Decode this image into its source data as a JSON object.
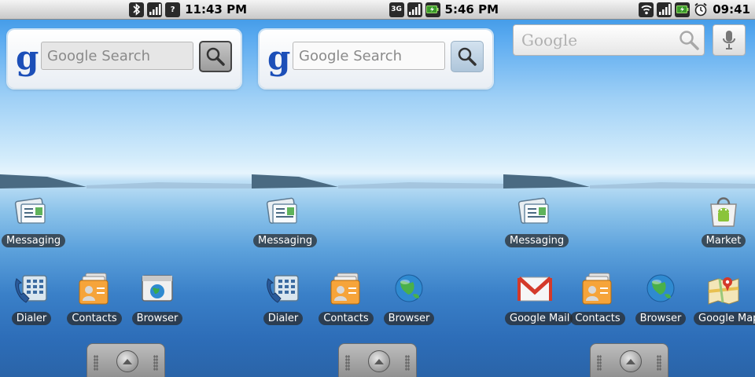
{
  "screens": [
    {
      "status": {
        "clock": "11:43 PM",
        "network_label": "",
        "icons": [
          "bluetooth-icon",
          "signal-icon",
          "unknown-icon"
        ]
      },
      "search": {
        "style": "classic",
        "placeholder": "Google Search",
        "logo": "g"
      },
      "apps": [
        {
          "label": "Messaging",
          "icon": "messaging-icon"
        },
        {
          "label": "Dialer",
          "icon": "dialer-icon"
        },
        {
          "label": "Contacts",
          "icon": "contacts-icon"
        },
        {
          "label": "Browser",
          "icon": "browser-icon"
        }
      ]
    },
    {
      "status": {
        "clock": "5:46 PM",
        "network_label": "3G",
        "icons": [
          "3g-icon",
          "signal-icon",
          "battery-icon"
        ]
      },
      "search": {
        "style": "classic",
        "placeholder": "Google Search",
        "logo": "g"
      },
      "apps": [
        {
          "label": "Messaging",
          "icon": "messaging-icon"
        },
        {
          "label": "Dialer",
          "icon": "dialer-icon"
        },
        {
          "label": "Contacts",
          "icon": "contacts-icon"
        },
        {
          "label": "Browser",
          "icon": "globe-icon"
        }
      ]
    },
    {
      "status": {
        "clock": "09:41",
        "network_label": "",
        "icons": [
          "wifi-icon",
          "signal-icon",
          "battery-icon",
          "alarm-icon"
        ]
      },
      "search": {
        "style": "modern",
        "placeholder": "Google"
      },
      "apps": [
        {
          "label": "Messaging",
          "icon": "messaging-icon"
        },
        {
          "label": "Market",
          "icon": "market-icon"
        },
        {
          "label": "Google Mail",
          "icon": "gmail-icon"
        },
        {
          "label": "Contacts",
          "icon": "contacts-icon"
        },
        {
          "label": "Browser",
          "icon": "globe-icon"
        },
        {
          "label": "Google Maps",
          "icon": "maps-icon"
        }
      ]
    }
  ],
  "colors": {
    "label_bg": "#3a3a3a",
    "logo_blue": "#1c4fb8"
  }
}
